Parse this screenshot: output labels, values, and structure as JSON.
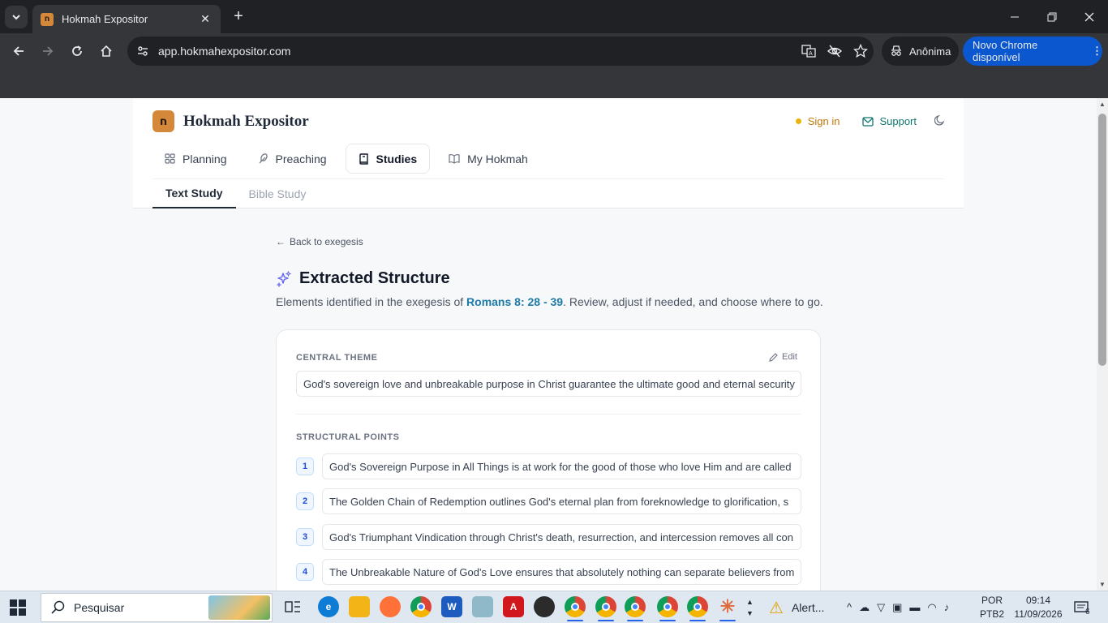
{
  "browser": {
    "tab_title": "Hokmah Expositor",
    "url": "app.hokmahexpositor.com",
    "incognito_label": "Anônima",
    "update_label": "Novo Chrome disponível"
  },
  "header": {
    "brand": "Hokmah Expositor",
    "logo_glyph": "ח",
    "sign_in": "Sign in",
    "support": "Support"
  },
  "main_nav": [
    {
      "label": "Planning",
      "icon": "grid-icon"
    },
    {
      "label": "Preaching",
      "icon": "feather-icon"
    },
    {
      "label": "Studies",
      "icon": "book-icon",
      "active": true
    },
    {
      "label": "My Hokmah",
      "icon": "open-book-icon"
    }
  ],
  "sub_nav": [
    {
      "label": "Text Study",
      "active": true
    },
    {
      "label": "Bible Study"
    }
  ],
  "content": {
    "back_link": "Back to exegesis",
    "title": "Extracted Structure",
    "lead_prefix": "Elements identified in the exegesis of ",
    "lead_ref": "Romans 8: 28 - 39",
    "lead_suffix": ". Review, adjust if needed, and choose where to go.",
    "central_theme_label": "CENTRAL THEME",
    "edit_label": "Edit",
    "central_theme": "God's sovereign love and unbreakable purpose in Christ guarantee the ultimate good and eternal security",
    "structural_points_label": "STRUCTURAL POINTS",
    "points": [
      {
        "num": "1",
        "text": "God's Sovereign Purpose in All Things is at work for the good of those who love Him and are called"
      },
      {
        "num": "2",
        "text": "The Golden Chain of Redemption outlines God's eternal plan from foreknowledge to glorification, s"
      },
      {
        "num": "3",
        "text": "God's Triumphant Vindication through Christ's death, resurrection, and intercession removes all con"
      },
      {
        "num": "4",
        "text": "The Unbreakable Nature of God's Love ensures that absolutely nothing can separate believers from"
      }
    ]
  },
  "taskbar": {
    "search_placeholder": "Pesquisar",
    "alert_label": "Alert...",
    "lang_line1": "POR",
    "lang_line2": "PTB2",
    "time": "09:14",
    "date": "11/09/2026",
    "notification_count": "6"
  },
  "colors": {
    "brand_accent": "#d4883a",
    "ref_link": "#1d7aa8",
    "support": "#0f766e",
    "sign_in": "#c2780b"
  }
}
